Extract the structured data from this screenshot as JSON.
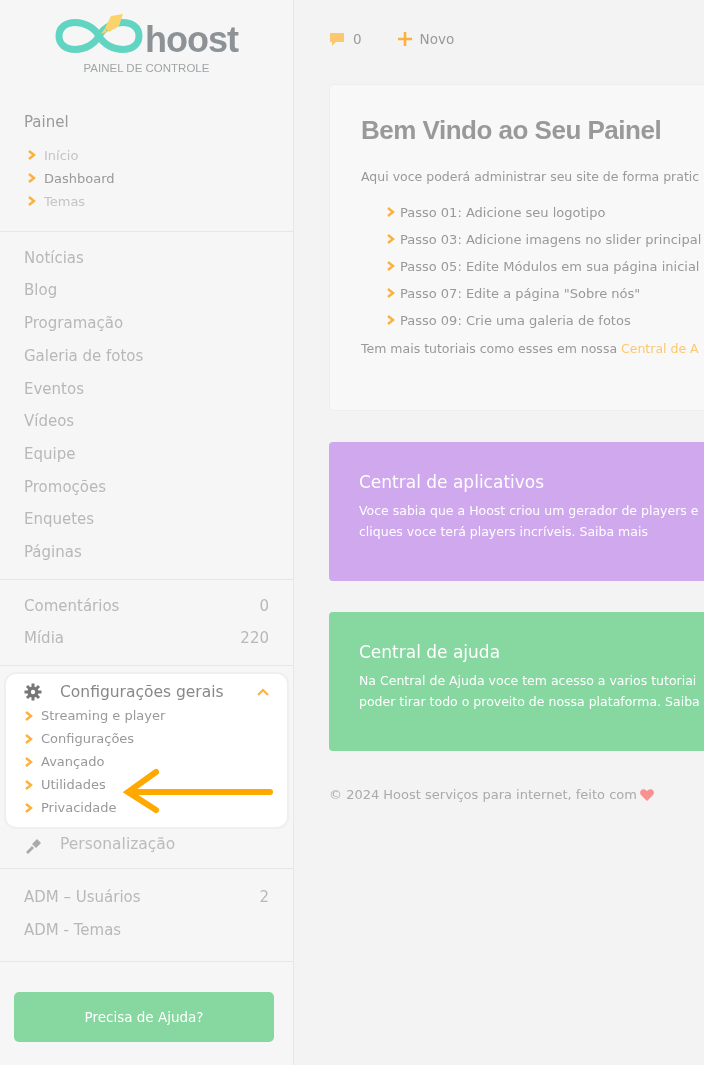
{
  "logo": {
    "wordmark": "hoost",
    "subtitle": "PAINEL DE CONTROLE"
  },
  "sidebar": {
    "painel": {
      "title": "Painel",
      "items": [
        {
          "label": "Início",
          "selected": false
        },
        {
          "label": "Dashboard",
          "selected": true
        },
        {
          "label": "Temas",
          "selected": false
        }
      ]
    },
    "groups": [
      [
        {
          "label": "Notícias"
        },
        {
          "label": "Blog"
        },
        {
          "label": "Programação"
        },
        {
          "label": "Galeria de fotos"
        },
        {
          "label": "Eventos"
        },
        {
          "label": "Vídeos"
        },
        {
          "label": "Equipe"
        },
        {
          "label": "Promoções"
        },
        {
          "label": "Enquetes"
        },
        {
          "label": "Páginas"
        }
      ],
      [
        {
          "label": "Comentários",
          "count": "0"
        },
        {
          "label": "Mídia",
          "count": "220"
        }
      ]
    ],
    "settings": [
      {
        "kind": "gear",
        "label": "Configurações gerais",
        "expanded": true,
        "children": [
          {
            "label": "Streaming e player"
          },
          {
            "label": "Configurações"
          },
          {
            "label": "Avançado"
          },
          {
            "label": "Utilidades"
          },
          {
            "label": "Privacidade"
          }
        ]
      },
      {
        "kind": "brush",
        "label": "Personalização",
        "expanded": false
      }
    ],
    "admin": [
      {
        "label": "ADM – Usuários",
        "count": "2"
      },
      {
        "label": "ADM - Temas"
      }
    ],
    "help_button": "Precisa de Ajuda?"
  },
  "topbar": {
    "comments": "0",
    "new": "Novo"
  },
  "welcome": {
    "title": "Bem Vindo ao Seu Painel",
    "intro": "Aqui voce poderá administrar seu site de forma pratic",
    "steps": [
      "Passo 01: Adicione seu logotipo",
      "Passo 03: Adicione imagens no slider principal",
      "Passo 05: Edite Módulos em sua página inicial",
      "Passo 07: Edite a página \"Sobre nós\"",
      "Passo 09: Crie uma galeria de fotos"
    ],
    "more": "Tem mais tutoriais como esses em nossa",
    "more_link": "Central de A"
  },
  "cards": [
    {
      "title": "Central de aplicativos",
      "lines": [
        "Voce sabia que a Hoost criou um gerador de players e",
        "cliques voce terá players incríveis. Saiba mais"
      ],
      "color": "#d0a8ee"
    },
    {
      "title": "Central de ajuda",
      "lines": [
        "Na Central de Ajuda voce tem acesso a varios tutoriai",
        "poder tirar todo o proveito de nossa plataforma. Saiba"
      ],
      "color": "#86d8a0"
    }
  ],
  "footer": "© 2024 Hoost serviços para internet, feito com"
}
